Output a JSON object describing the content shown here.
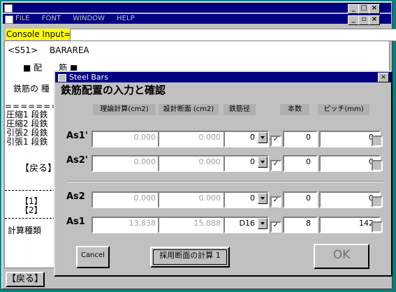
{
  "app": {
    "menu": [
      "FILE",
      "FONT",
      "WINDOW",
      "HELP"
    ],
    "console_label": "Console Input=",
    "console_value": "",
    "lines": {
      "cmd": "<S51>",
      "cmd_arg": "BARAREA",
      "section_title": "■ 配　　筋 ■",
      "bar_kind": "鉄筋の 種",
      "divider": "=========",
      "comp1": "圧縮1 段鉄",
      "comp2": "圧縮2 段鉄",
      "tens2": "引張2 段鉄",
      "tens1": "引張1 段鉄",
      "back": "【戻る】",
      "opt1": "【1】",
      "opt2": "【2】",
      "calc_type": "計算種類"
    },
    "bottom_back": "【戻る】"
  },
  "dialog": {
    "title": "Steel Bars",
    "heading": "鉄筋配置の入力と確認",
    "columns": [
      "理論計算(cm2)",
      "設計断面 (cm2)",
      "鉄筋径",
      "本数",
      "ピッチ(mm)"
    ],
    "rows": [
      {
        "label": "As1'",
        "theory": "0.000",
        "design": "0.000",
        "dia": "0",
        "checked": true,
        "count": "0",
        "pitch": "0"
      },
      {
        "label": "As2'",
        "theory": "0.000",
        "design": "0.000",
        "dia": "0",
        "checked": true,
        "count": "0",
        "pitch": "0"
      },
      {
        "label": "As2",
        "theory": "0.000",
        "design": "0.000",
        "dia": "0",
        "checked": true,
        "count": "0",
        "pitch": "0"
      },
      {
        "label": "As1",
        "theory": "13.838",
        "design": "15.888",
        "dia": "D16",
        "checked": true,
        "count": "8",
        "pitch": "142"
      }
    ],
    "cancel_label": "Cancel",
    "calc_label": "採用断面の計算 1",
    "ok_label": "OK"
  }
}
